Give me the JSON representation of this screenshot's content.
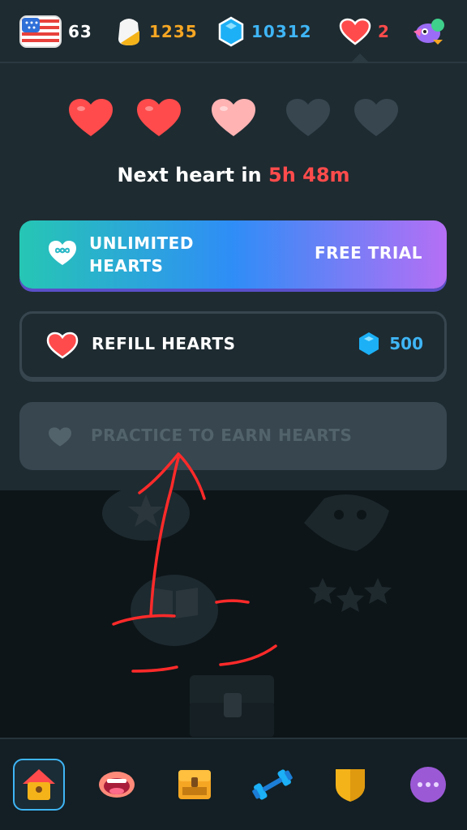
{
  "topbar": {
    "course_flag_icon": "us-flag-icon",
    "course_count": "63",
    "streak_icon": "streak-flame-icon",
    "streak_count": "1235",
    "gems_icon": "gem-icon",
    "gems_count": "10312",
    "hearts_icon": "heart-icon",
    "hearts_count": "2",
    "avatar_icon": "profile-avatar-icon"
  },
  "hearts_panel": {
    "hearts": [
      {
        "state": "full"
      },
      {
        "state": "full"
      },
      {
        "state": "refilling"
      },
      {
        "state": "empty"
      },
      {
        "state": "empty"
      }
    ],
    "next_heart_prefix": "Next heart in",
    "next_heart_time": "5h 48m",
    "unlimited": {
      "label": "UNLIMITED HEARTS",
      "action": "FREE TRIAL",
      "icon": "infinity-heart-icon"
    },
    "refill": {
      "label": "REFILL HEARTS",
      "cost": "500",
      "icon": "heart-icon",
      "cost_icon": "gem-icon"
    },
    "practice": {
      "label": "PRACTICE TO EARN HEARTS",
      "icon": "heart-icon"
    }
  },
  "nav": {
    "items": [
      {
        "name": "learn",
        "icon": "home-icon",
        "active": true
      },
      {
        "name": "speak",
        "icon": "mouth-icon",
        "active": false
      },
      {
        "name": "stories",
        "icon": "chest-icon",
        "active": false
      },
      {
        "name": "practice",
        "icon": "dumbbell-icon",
        "active": false
      },
      {
        "name": "leagues",
        "icon": "shield-icon",
        "active": false
      },
      {
        "name": "more",
        "icon": "more-dots-icon",
        "active": false
      }
    ]
  },
  "colors": {
    "background": "#131f24",
    "panel": "#1e2b31",
    "heart_red": "#ff4b4b",
    "gem_blue": "#3fb5f5",
    "streak_orange": "#f5a623",
    "annotation_red": "#ff2a2a"
  }
}
